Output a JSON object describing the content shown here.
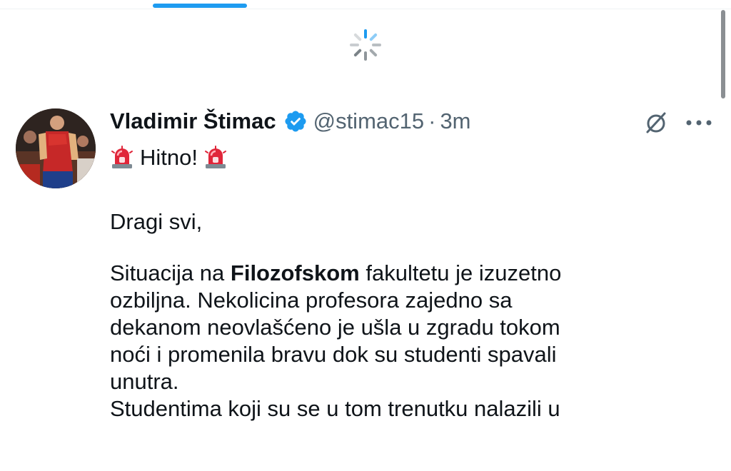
{
  "tweet": {
    "display_name": "Vladimir Štimac",
    "handle": "@stimac15",
    "separator": "·",
    "time": "3m",
    "headline": "Hitno!",
    "greeting": "Dragi svi,",
    "p1_part1": "Situacija na ",
    "p1_bold": "Filozofskom",
    "p1_part2": " fakultetu je izuzetno",
    "lines": [
      "ozbiljna. Nekolicina profesora zajedno sa",
      "dekanom neovlašćeno je ušla u zgradu tokom",
      "noći i promenila bravu dok su studenti spavali",
      "unutra.",
      "Studentima koji su se u tom trenutku nalazili u"
    ]
  },
  "icons": {
    "loading": "loading-spinner-icon",
    "verified": "verified-badge-icon",
    "grok": "grok-icon",
    "more": "more-icon",
    "siren": "police-light-emoji"
  },
  "colors": {
    "accent": "#1d9bf0",
    "text": "#0f1419",
    "secondary": "#536471",
    "siren_red": "#e0263a"
  }
}
